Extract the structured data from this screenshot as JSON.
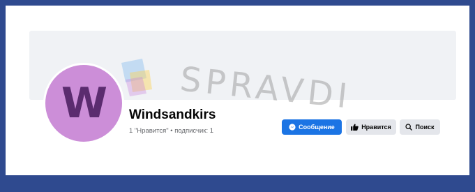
{
  "page": {
    "name": "Windsandkirs",
    "stats": "1 \"Нравится\" • подписчик: 1",
    "avatar_letter": "W"
  },
  "actions": {
    "message_label": "Сообщение",
    "like_label": "Нравится",
    "search_label": "Поиск"
  },
  "watermark": {
    "text": "SPRAVDI"
  },
  "colors": {
    "frame_blue": "#2f4a8f",
    "primary_blue": "#1b74e4",
    "avatar_bg": "#cc8ed8",
    "avatar_letter": "#5b2c6f"
  },
  "icons": {
    "message": "messenger-icon",
    "like": "thumbs-up-icon",
    "search": "search-icon"
  }
}
